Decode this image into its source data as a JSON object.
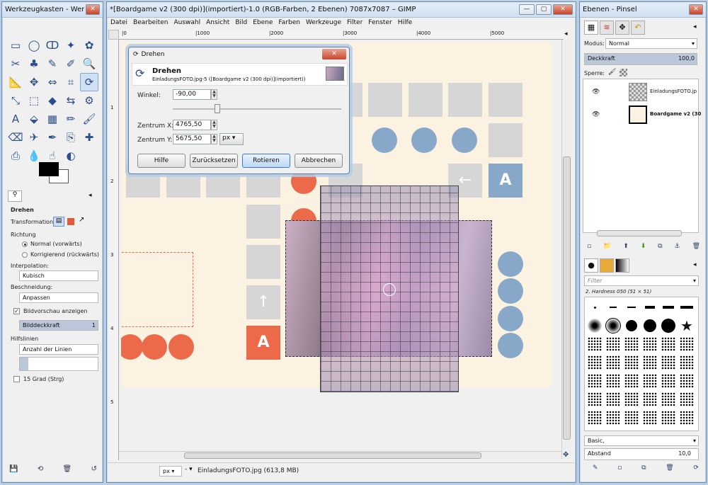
{
  "toolbox": {
    "title": "Werkzeugkasten - Werkz...",
    "tool_icons": [
      "rect-select-icon",
      "ellipse-select-icon",
      "lasso-icon",
      "fuzzy-select-icon",
      "color-select-icon",
      "scissors-icon",
      "foreground-select-icon",
      "paths-icon",
      "color-picker-icon",
      "magnify-icon",
      "measure-icon",
      "move-icon",
      "align-icon",
      "crop-icon",
      "rotate-icon",
      "scale-icon",
      "shear-icon",
      "perspective-icon",
      "flip-icon",
      "cage-icon",
      "text-icon",
      "bucket-fill-icon",
      "blend-icon",
      "pencil-icon",
      "paintbrush-icon",
      "eraser-icon",
      "airbrush-icon",
      "ink-icon",
      "clone-icon",
      "heal-icon",
      "perspective-clone-icon",
      "blur-icon",
      "smudge-icon",
      "dodge-icon"
    ],
    "tool_glyphs": [
      "▭",
      "◯",
      "ↀ",
      "✦",
      "✿",
      "✂",
      "♣",
      "✎",
      "✐",
      "🔍",
      "📐",
      "✥",
      "⇔",
      "⌗",
      "⟳",
      "⤡",
      "⬚",
      "◆",
      "⇆",
      "⚙",
      "A",
      "⬙",
      "▦",
      "✏",
      "🖌",
      "⌫",
      "✈",
      "✒",
      "⎘",
      "✚",
      "⎙",
      "💧",
      "☝",
      "◐"
    ],
    "selected_tool": 14,
    "tool_options_title": "Drehen",
    "transformation_label": "Transformation:",
    "richtung_label": "Richtung",
    "radio_normal": "Normal (vorwärts)",
    "radio_korr": "Korrigierend (rückwärts)",
    "interpolation_label": "Interpolation:",
    "interpolation_value": "Kubisch",
    "beschneidung_label": "Beschneidung:",
    "beschneidung_value": "Anpassen",
    "preview_label": "Bildvorschau anzeigen",
    "deckkraft_label": "Bilddeckkraft",
    "deckkraft_value": "1",
    "hilfslinien_label": "Hilfslinien",
    "hilfslinien_value": "Anzahl der Linien",
    "grad_label": "15 Grad (Strg)"
  },
  "main": {
    "title": "*[Boardgame v2 (300 dpi)](importiert)-1.0 (RGB-Farben, 2 Ebenen) 7087x7087 – GIMP",
    "menu": [
      "Datei",
      "Bearbeiten",
      "Auswahl",
      "Ansicht",
      "Bild",
      "Ebene",
      "Farben",
      "Werkzeuge",
      "Filter",
      "Fenster",
      "Hilfe"
    ],
    "ruler_ticks": [
      "|0",
      "|1000",
      "|2000",
      "|3000",
      "|4000",
      "|5000"
    ],
    "vruler_ticks": [
      "1",
      "2",
      "3",
      "4",
      "5"
    ],
    "tile_a": "A",
    "tile_arrow_up": "↑",
    "tile_arrow_left": "←",
    "status_unit": "px",
    "status_text": "EinladungsFOTO.jpg (613,8 MB)",
    "colors": {
      "blue": "#87a8c8",
      "orange": "#ec6a4a",
      "grey": "#d6d6d6",
      "bg": "#fcf2e2"
    }
  },
  "dialog": {
    "title": "Drehen",
    "header": "Drehen",
    "subheader": "EinladungsFOTO.jpg-5 ([Boardgame v2 (300 dpi)](importiert))",
    "winkel_label": "Winkel:",
    "winkel_value": "-90,00",
    "zentrum_x_label": "Zentrum X:",
    "zentrum_x_value": "4765,50",
    "zentrum_y_label": "Zentrum Y:",
    "zentrum_y_value": "5675,50",
    "unit": "px",
    "btn_hilfe": "Hilfe",
    "btn_reset": "Zurücksetzen",
    "btn_rotate": "Rotieren",
    "btn_cancel": "Abbrechen"
  },
  "layers": {
    "title": "Ebenen - Pinsel",
    "modus_label": "Modus:",
    "modus_value": "Normal",
    "deckkraft_label": "Deckkraft",
    "deckkraft_value": "100,0",
    "sperre_label": "Sperre:",
    "layer1": "EinladungsFOTO.jp",
    "layer2": "Boardgame v2 (30",
    "filter_placeholder": "Filter",
    "brush_name": "2. Hardness 050 (51 × 51)",
    "brush_tag": "Basic,",
    "abstand_label": "Abstand",
    "abstand_value": "10,0"
  }
}
